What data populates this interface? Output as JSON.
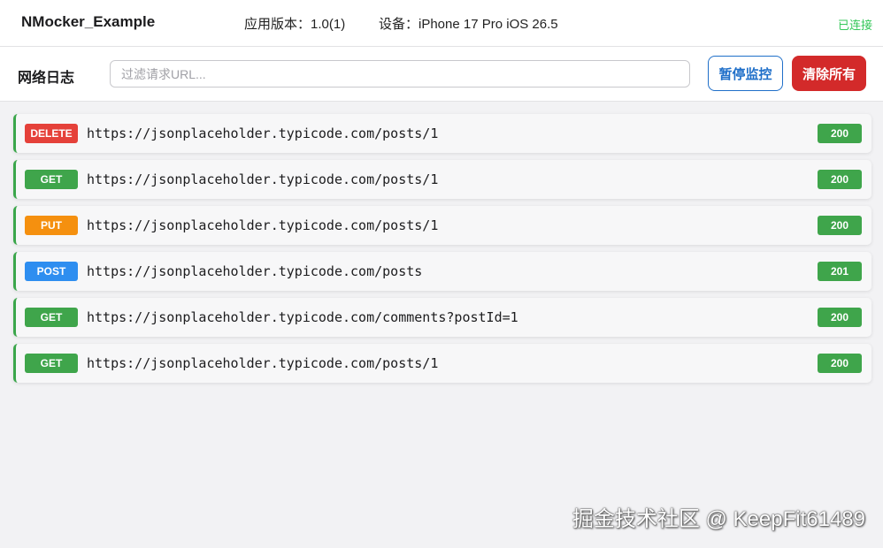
{
  "header": {
    "app_name": "NMocker_Example",
    "version_text": "应用版本：1.0(1)",
    "device_text": "设备：iPhone 17 Pro  iOS 26.5",
    "status": "已连接"
  },
  "toolbar": {
    "title": "网络日志",
    "filter_placeholder": "过滤请求URL...",
    "filter_value": "",
    "pause_label": "暂停监控",
    "clear_label": "清除所有"
  },
  "requests": [
    {
      "method": "DELETE",
      "url": "https://jsonplaceholder.typicode.com/posts/1",
      "status": "200"
    },
    {
      "method": "GET",
      "url": "https://jsonplaceholder.typicode.com/posts/1",
      "status": "200"
    },
    {
      "method": "PUT",
      "url": "https://jsonplaceholder.typicode.com/posts/1",
      "status": "200"
    },
    {
      "method": "POST",
      "url": "https://jsonplaceholder.typicode.com/posts",
      "status": "201"
    },
    {
      "method": "GET",
      "url": "https://jsonplaceholder.typicode.com/comments?postId=1",
      "status": "200"
    },
    {
      "method": "GET",
      "url": "https://jsonplaceholder.typicode.com/posts/1",
      "status": "200"
    }
  ],
  "colors": {
    "accent": "#1f6fc9",
    "danger": "#d32a2a",
    "connected": "#34c759",
    "success": "#3fa54b"
  },
  "watermark": "掘金技术社区 @ KeepFit61489"
}
